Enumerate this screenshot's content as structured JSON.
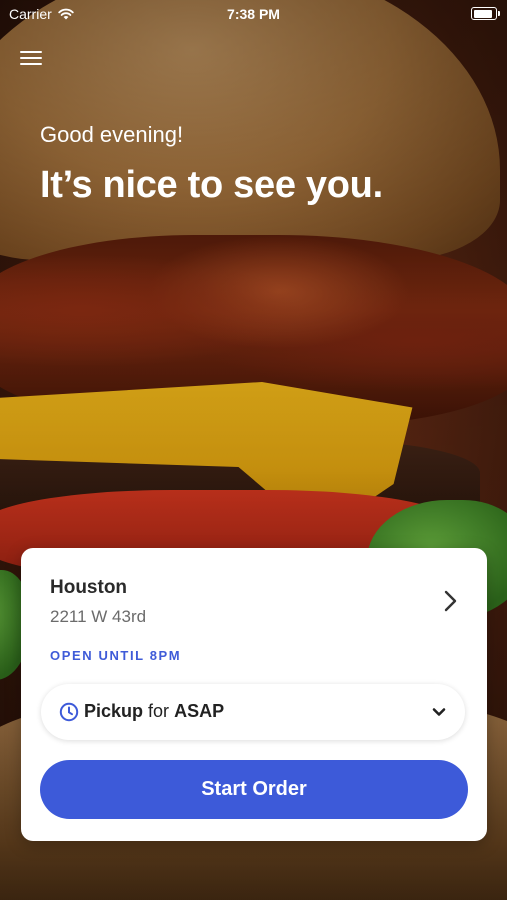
{
  "status_bar": {
    "carrier": "Carrier",
    "time": "7:38 PM",
    "battery_level": 1.0,
    "wifi_icon": "wifi-icon",
    "battery_icon": "battery-icon"
  },
  "header": {
    "menu_icon": "hamburger-menu-icon",
    "greeting": "Good evening!",
    "headline": "It’s nice to see you."
  },
  "location": {
    "name": "Houston",
    "address": "2211 W 43rd",
    "hours": "OPEN UNTIL 8PM",
    "chevron_icon": "chevron-right-icon"
  },
  "pickup": {
    "icon": "clock-icon",
    "mode": "Pickup",
    "connector": "for",
    "time": "ASAP",
    "dropdown_icon": "chevron-down-icon"
  },
  "actions": {
    "start_order": "Start Order"
  },
  "colors": {
    "accent": "#3d5ad9",
    "hours_text": "#3f5bd8"
  }
}
